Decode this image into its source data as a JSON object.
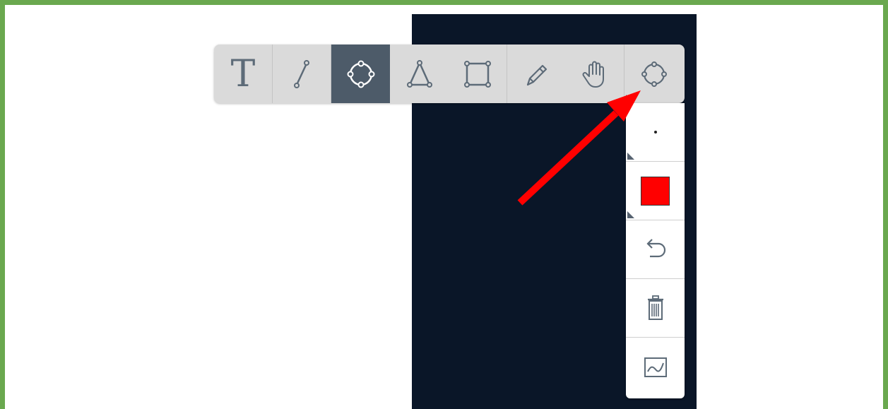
{
  "toolbar": {
    "tools": [
      {
        "icon": "text-tool-icon",
        "label": "T"
      },
      {
        "icon": "line-tool-icon"
      },
      {
        "icon": "circle-tool-icon",
        "active": true
      },
      {
        "icon": "triangle-tool-icon"
      },
      {
        "icon": "rectangle-tool-icon"
      },
      {
        "icon": "pencil-tool-icon"
      },
      {
        "icon": "pan-hand-icon"
      },
      {
        "icon": "shape-selector-icon"
      }
    ]
  },
  "side_panel": {
    "items": [
      {
        "icon": "stroke-width-dot-icon"
      },
      {
        "icon": "color-picker",
        "color": "#ff0000"
      },
      {
        "icon": "undo-icon"
      },
      {
        "icon": "trash-icon"
      },
      {
        "icon": "chart-type-icon"
      }
    ]
  },
  "annotation": {
    "arrow_color": "#ff0000"
  },
  "colors": {
    "frame_border": "#6aa84f",
    "chart_background": "#0a1628",
    "active_tool": "#4d5b69"
  }
}
